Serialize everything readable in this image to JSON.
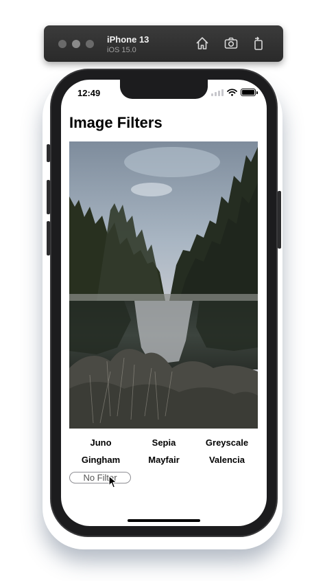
{
  "simulator": {
    "device_name": "iPhone 13",
    "os_version": "iOS 15.0"
  },
  "status_bar": {
    "time": "12:49"
  },
  "app": {
    "title": "Image Filters",
    "filters": [
      "Juno",
      "Sepia",
      "Greyscale",
      "Gingham",
      "Mayfair",
      "Valencia"
    ],
    "no_filter_label": "No Filter"
  },
  "colors": {
    "accent": "#8e8e93",
    "sky": "#8fa3b8",
    "forest": "#2a3328",
    "water": "#3e4641"
  }
}
